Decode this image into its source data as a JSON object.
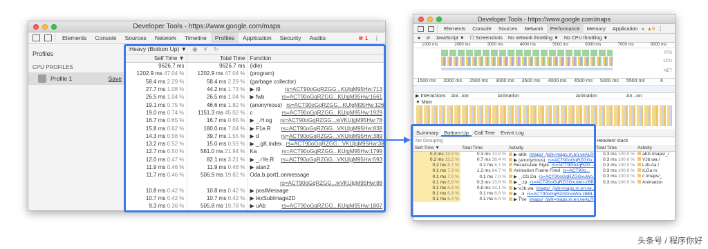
{
  "left": {
    "title": "Developer Tools - https://www.google.com/maps",
    "tabs": [
      "Elements",
      "Console",
      "Sources",
      "Network",
      "Timeline",
      "Profiles",
      "Application",
      "Security",
      "Audits"
    ],
    "active_tab": "Profiles",
    "error_count": "1",
    "sidebar": {
      "title": "Profiles",
      "section": "CPU PROFILES",
      "profile_label": "Profile 1",
      "save_label": "Save"
    },
    "view_select": "Heavy (Bottom Up)",
    "columns": [
      "Self Time",
      "Total Time",
      "Function"
    ],
    "rows": [
      {
        "self": "9626.7 ms",
        "sp": "",
        "total": "9626.7 ms",
        "tp": "",
        "fn": "(idle)",
        "link": ""
      },
      {
        "self": "1202.9 ms",
        "sp": "47.04 %",
        "total": "1202.9 ms",
        "tp": "47.04 %",
        "fn": "(program)",
        "link": ""
      },
      {
        "self": "58.4 ms",
        "sp": "2.29 %",
        "total": "58.4 ms",
        "tp": "2.29 %",
        "fn": "(garbage collector)",
        "link": ""
      },
      {
        "self": "27.7 ms",
        "sp": "1.08 %",
        "total": "44.2 ms",
        "tp": "1.73 %",
        "fn": "▶ t9",
        "link": "rs=ACT90oGqRZGG...KUlgM95Hw:713"
      },
      {
        "self": "26.5 ms",
        "sp": "1.04 %",
        "total": "26.5 ms",
        "tp": "1.04 %",
        "fn": "▶ fwb",
        "link": "rs=ACT90oGqRZGG...KUlgM95Hw:1661"
      },
      {
        "self": "19.1 ms",
        "sp": "0.75 %",
        "total": "46.6 ms",
        "tp": "1.82 %",
        "fn": "(anonymous)",
        "link": "rs=ACT90oGqRZGG...KUlgM95Hw:126"
      },
      {
        "self": "19.0 ms",
        "sp": "0.74 %",
        "total": "1151.3 ms",
        "tp": "45.02 %",
        "fn": "c",
        "link": "rs=ACT90oGqRZGG...KUlgM95Hw:1929"
      },
      {
        "self": "16.7 ms",
        "sp": "0.65 %",
        "total": "16.7 ms",
        "tp": "0.65 %",
        "fn": "▶ _.H.og",
        "link": "rs=ACT90oGqRZGG...wVKUlgM95Hw:78"
      },
      {
        "self": "15.8 ms",
        "sp": "0.62 %",
        "total": "180.0 ms",
        "tp": "7.04 %",
        "fn": "▶ F1e.R",
        "link": "rs=ACT90oGqRZGG...VKUlgM95Hw:838"
      },
      {
        "self": "14.3 ms",
        "sp": "0.56 %",
        "total": "39.7 ms",
        "tp": "1.55 %",
        "fn": "▶ d",
        "link": "rs=ACT90oGqRZGG...VKUlgM95Hw:389"
      },
      {
        "self": "13.2 ms",
        "sp": "0.52 %",
        "total": "15.0 ms",
        "tp": "0.59 %",
        "fn": "▶ _.gK.index",
        "link": "rs=ACT90oGqRZGG...VKUlgM95Hw:381"
      },
      {
        "self": "12.7 ms",
        "sp": "0.50 %",
        "total": "561.0 ms",
        "tp": "21.94 %",
        "fn": "Ka",
        "link": "rs=ACT90oGqRZGG...KUlgM95Hw:1799"
      },
      {
        "self": "12.0 ms",
        "sp": "0.47 %",
        "total": "82.1 ms",
        "tp": "3.21 %",
        "fn": "▶ _.rYe.R",
        "link": "rs=ACT90oGqRZGG...VKUlgM95Hw:593"
      },
      {
        "self": "11.9 ms",
        "sp": "0.46 %",
        "total": "11.9 ms",
        "tp": "0.46 %",
        "fn": "▶ atan2",
        "link": ""
      },
      {
        "self": "11.7 ms",
        "sp": "0.46 %",
        "total": "506.9 ms",
        "tp": "19.82 %",
        "fn": "Oda.b.port1.onmessage",
        "link": ""
      },
      {
        "self": "",
        "sp": "",
        "total": "",
        "tp": "",
        "fn": "",
        "link": "rs=ACT90oGqRZGG...wVKUlgM95Hw:88"
      },
      {
        "self": "10.8 ms",
        "sp": "0.42 %",
        "total": "10.8 ms",
        "tp": "0.42 %",
        "fn": "▶ postMessage",
        "link": ""
      },
      {
        "self": "10.7 ms",
        "sp": "0.42 %",
        "total": "10.7 ms",
        "tp": "0.42 %",
        "fn": "▶ texSubImage2D",
        "link": ""
      },
      {
        "self": "9.3 ms",
        "sp": "0.36 %",
        "total": "505.8 ms",
        "tp": "19.78 %",
        "fn": "▶ uAb",
        "link": "rs=ACT90oGqRZGG...KUlgM95Hw:1807"
      }
    ]
  },
  "right": {
    "title": "Developer Tools - https://www.google.com/maps",
    "tabs": [
      "Elements",
      "Console",
      "Sources",
      "Network",
      "Performance",
      "Memory",
      "Application"
    ],
    "active_tab": "Performance",
    "more": "»",
    "warn_count": "6",
    "toolbar": {
      "context": "JavaScript",
      "screenshots": "Screenshots",
      "network": "No network throttling",
      "cpu": "No CPU throttling"
    },
    "overview_ticks": [
      "1000 ms",
      "2000 ms",
      "3000 ms",
      "4000 ms",
      "5000 ms",
      "6000 ms",
      "7000 ms",
      "8000 ms"
    ],
    "side_labels": [
      "FPS",
      "CPU",
      "NET"
    ],
    "ruler_ticks": [
      "1500 ms",
      "2000 ms",
      "2500 ms",
      "3000 ms",
      "3500 ms",
      "4000 ms",
      "4500 ms",
      "5000 ms",
      "5500 ms",
      "6"
    ],
    "interactions": {
      "label": "▶ Interactions",
      "items": [
        "Ani...ion",
        "Animation",
        "Animation",
        "An...on"
      ]
    },
    "main_label": "▼ Main",
    "bottom_tabs": [
      "Summary",
      "Bottom-Up",
      "Call Tree",
      "Event Log"
    ],
    "active_bottom_tab": "Bottom-Up",
    "grouping": "No Grouping",
    "columns": [
      "Self Time",
      "Total Time",
      "Activity"
    ],
    "rows": [
      {
        "self": "0.3 ms",
        "sp": "13.9 %",
        "total": "0.3 ms",
        "tp": "13.9 %",
        "act": "▶ aKb",
        "link": "/maps/_/js/k=maps.m.en.veALR"
      },
      {
        "self": "0.2 ms",
        "sp": "13.2 %",
        "total": "0.7 ms",
        "tp": "38.4 %",
        "act": "▶ (anonymous)",
        "link": "rs=ACT90oGqRZGGx..."
      },
      {
        "self": "0.2 ms",
        "sp": "8.7 %",
        "total": "0.2 ms",
        "tp": "8.7 %",
        "act": "Recalculate Style",
        "link": "rs=ACT90oGqRZG..."
      },
      {
        "self": "0.1 ms",
        "sp": "7.3 %",
        "total": "1.2 ms",
        "tp": "64.7 %",
        "act": "Animation Frame Fired",
        "link": "rs=ACT90o..."
      },
      {
        "self": "0.1 ms",
        "sp": "7.0 %",
        "total": "0.1 ms",
        "tp": "7.0 %",
        "act": "▶ _.CG.Da",
        "link": "rs=ACT90oGqRZGGxuWo..."
      },
      {
        "self": "0.1 ms",
        "sp": "6.8 %",
        "total": "0.3 ms",
        "tp": "13.6 %",
        "act": "▶ _.zp",
        "link": "rs=ACT90oGqRZGGxuWo-zBB..."
      },
      {
        "self": "0.1 ms",
        "sp": "6.8 %",
        "total": "0.6 ms",
        "tp": "34.1 %",
        "act": "▶ VJb.wa",
        "link": "/maps/_/js/k=maps.m.en.ve..."
      },
      {
        "self": "0.1 ms",
        "sp": "6.8 %",
        "total": "0.1 ms",
        "tp": "6.8 %",
        "act": "▶ _.li",
        "link": "rs=ACT90oGqRZGGxuWo-zBBL..."
      },
      {
        "self": "0.1 ms",
        "sp": "6.4 %",
        "total": "0.1 ms",
        "tp": "6.4 %",
        "act": "▶ TVe",
        "link": "/maps/_/js/k=maps.m.en.veALR"
      }
    ],
    "heaviest": {
      "title": "Heaviest stack",
      "columns": [
        "Total Time",
        "Activity"
      ],
      "rows": [
        {
          "t": "0.3 ms",
          "p": "100.0 %",
          "act": "aKb /maps/_/"
        },
        {
          "t": "0.3 ms",
          "p": "100.0 %",
          "act": "VJb.wa /"
        },
        {
          "t": "0.3 ms",
          "p": "100.0 %",
          "act": "LJb.Aa /"
        },
        {
          "t": "0.3 ms",
          "p": "100.0 %",
          "act": "ILGa rs"
        },
        {
          "t": "0.3 ms",
          "p": "100.0 %",
          "act": "c /maps/_"
        },
        {
          "t": "0.3 ms",
          "p": "100.0 %",
          "act": "Animation"
        }
      ]
    }
  },
  "watermark": "头条号 / 程序你好",
  "colors": {
    "accent": "#3c78e6",
    "highlight_row": "#fbeaa9"
  }
}
